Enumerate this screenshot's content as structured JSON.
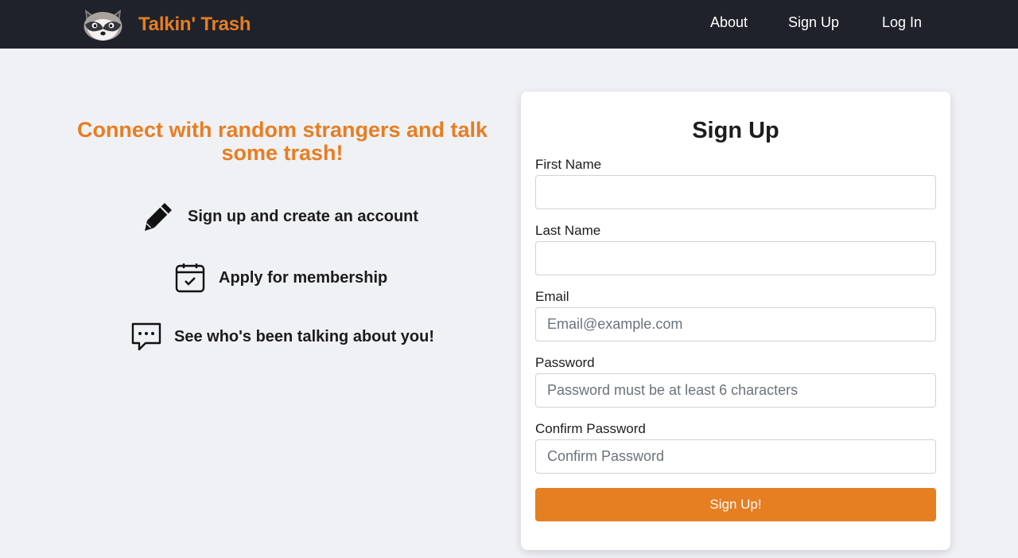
{
  "brand": {
    "name": "Talkin' Trash",
    "logo_icon": "raccoon-icon",
    "accent_color": "#e67e22"
  },
  "nav": {
    "items": [
      {
        "label": "About"
      },
      {
        "label": "Sign Up"
      },
      {
        "label": "Log In"
      }
    ]
  },
  "hero": {
    "headline": "Connect with random strangers and talk some trash!",
    "features": [
      {
        "icon": "pencil-icon",
        "text": "Sign up and create an account"
      },
      {
        "icon": "calendar-check-icon",
        "text": "Apply for membership"
      },
      {
        "icon": "chat-bubble-icon",
        "text": "See who's been talking about you!"
      }
    ]
  },
  "signup_form": {
    "title": "Sign Up",
    "fields": [
      {
        "label": "First Name",
        "placeholder": "",
        "value": ""
      },
      {
        "label": "Last Name",
        "placeholder": "",
        "value": ""
      },
      {
        "label": "Email",
        "placeholder": "Email@example.com",
        "value": ""
      },
      {
        "label": "Password",
        "placeholder": "Password must be at least 6 characters",
        "value": ""
      },
      {
        "label": "Confirm Password",
        "placeholder": "Confirm Password",
        "value": ""
      }
    ],
    "submit_label": "Sign Up!"
  }
}
